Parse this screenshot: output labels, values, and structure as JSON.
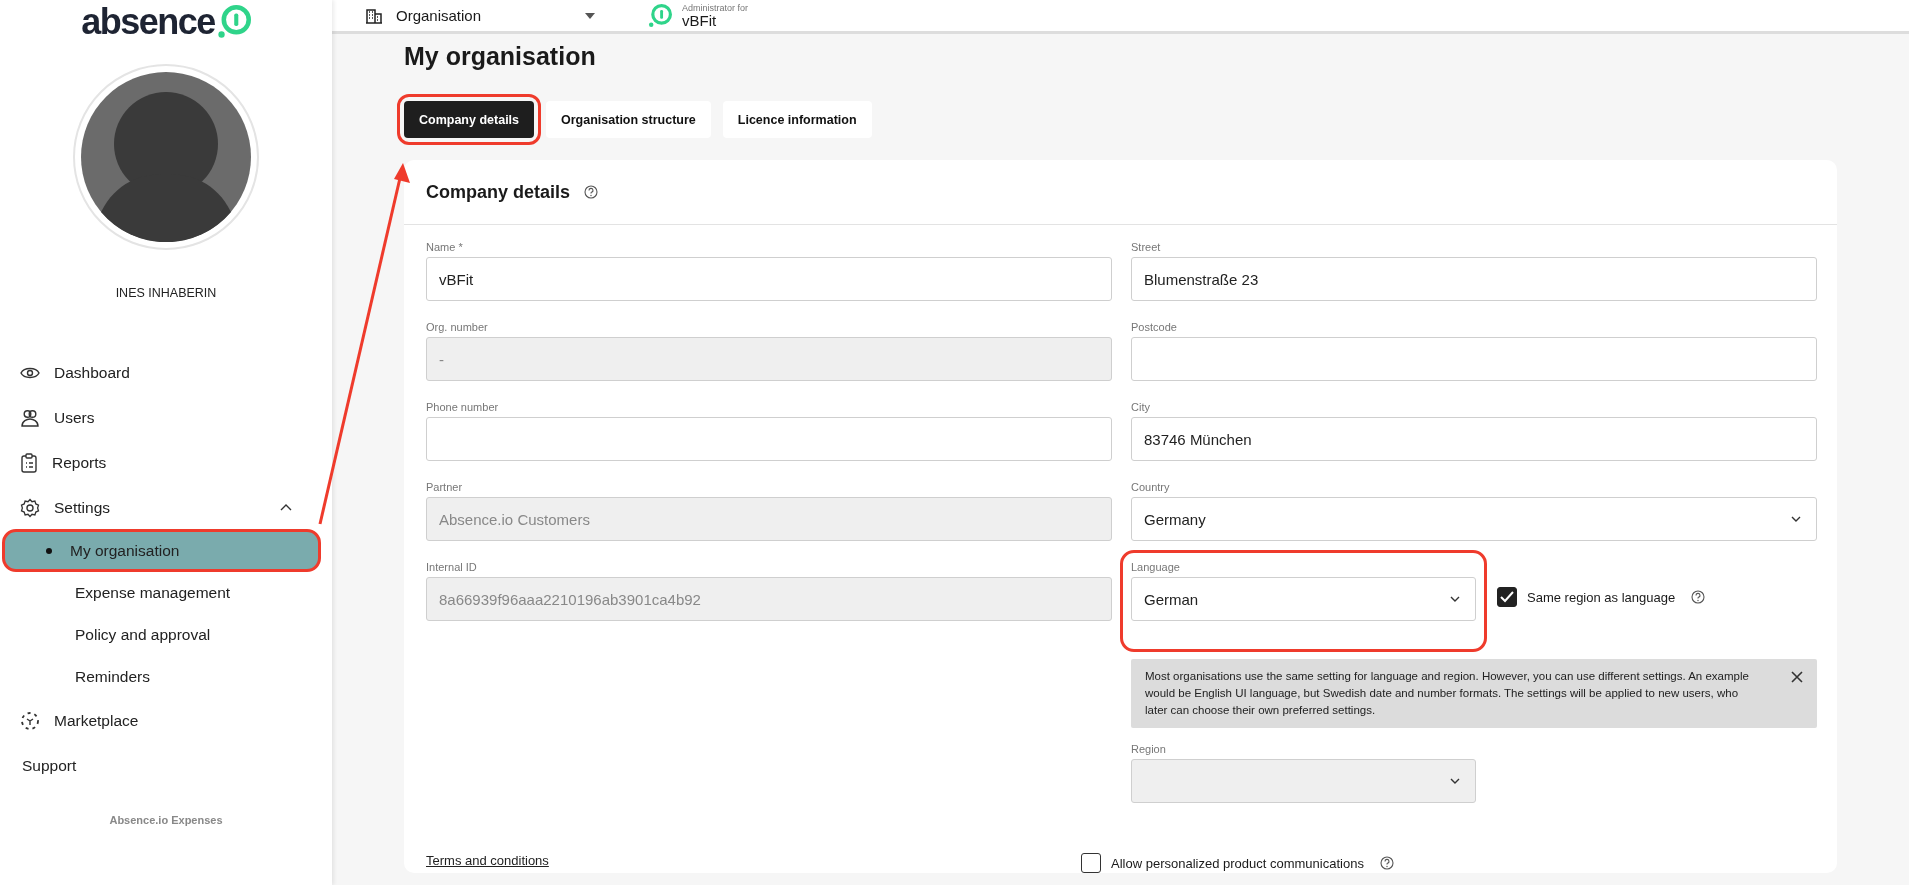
{
  "sidebar": {
    "logo": "absence",
    "user_name": "INES INHABERIN",
    "items": [
      {
        "label": "Dashboard",
        "selected": false
      },
      {
        "label": "Users",
        "selected": false
      },
      {
        "label": "Reports",
        "selected": false
      },
      {
        "label": "Settings",
        "selected": false,
        "expanded": true,
        "children": [
          {
            "label": "My organisation",
            "selected": true,
            "highlighted": true
          },
          {
            "label": "Expense management",
            "selected": false,
            "highlighted": false
          },
          {
            "label": "Policy and approval",
            "selected": false,
            "highlighted": false
          },
          {
            "label": "Reminders",
            "selected": false,
            "highlighted": false
          }
        ]
      },
      {
        "label": "Marketplace",
        "selected": false
      },
      {
        "label": "Support",
        "selected": false
      }
    ],
    "footer": "Absence.io Expenses"
  },
  "header": {
    "organisation_select": "Organisation",
    "admin_label": "Administrator for",
    "admin_org": "vBFit"
  },
  "page_title": "My organisation",
  "tabs": [
    {
      "label": "Company details",
      "selected": true,
      "highlighted": true
    },
    {
      "label": "Organisation structure",
      "selected": false,
      "highlighted": false
    },
    {
      "label": "Licence information",
      "selected": false,
      "highlighted": false
    }
  ],
  "card": {
    "title": "Company details",
    "left_fields": [
      {
        "label": "Name *",
        "value": "vBFit",
        "disabled": false
      },
      {
        "label": "Org. number",
        "value": "-",
        "disabled": true
      },
      {
        "label": "Phone number",
        "disabled": false
      },
      {
        "label": "Partner",
        "value": "Absence.io Customers",
        "disabled": true
      },
      {
        "label": "Internal ID",
        "value": "8a66939f96aaa2210196ab3901ca4b92",
        "disabled": true
      }
    ],
    "right_fields": [
      {
        "label": "Street",
        "value": "Blumenstraße 23",
        "kind": "text",
        "disabled": false
      },
      {
        "label": "Postcode",
        "kind": "text",
        "disabled": false
      },
      {
        "label": "City",
        "value": "83746 München",
        "kind": "text",
        "disabled": false
      },
      {
        "label": "Country",
        "value": "Germany",
        "kind": "select",
        "disabled": false
      },
      {
        "label": "Language",
        "value": "German",
        "kind": "select",
        "disabled": false,
        "highlighted": true
      }
    ],
    "same_region": {
      "label": "Same region as language",
      "checked": true
    },
    "info": "Most organisations use the same setting for language and region. However, you can use different settings. An example would be English UI language, but Swedish date and number formats. The settings will be applied to new users, who later can choose their own preferred settings.",
    "region": {
      "label": "Region",
      "disabled": true
    },
    "terms_link": "Terms and conditions",
    "communications": {
      "label": "Allow personalized product communications",
      "checked": false
    }
  }
}
